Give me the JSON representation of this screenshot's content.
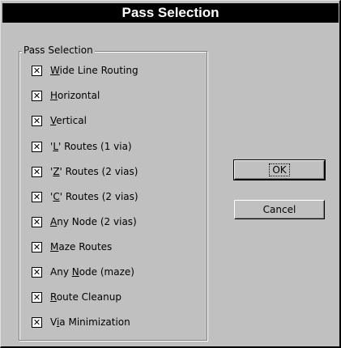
{
  "window": {
    "title": "Pass Selection"
  },
  "group": {
    "label": "Pass Selection"
  },
  "passes": [
    {
      "pre": "",
      "u": "W",
      "post": "ide Line Routing",
      "checked": true
    },
    {
      "pre": "",
      "u": "H",
      "post": "orizontal",
      "checked": true
    },
    {
      "pre": "",
      "u": "V",
      "post": "ertical",
      "checked": true
    },
    {
      "pre": "'",
      "u": "L",
      "post": "' Routes (1 via)",
      "checked": true
    },
    {
      "pre": "'",
      "u": "Z",
      "post": "' Routes (2 vias)",
      "checked": true
    },
    {
      "pre": "'",
      "u": "C",
      "post": "' Routes (2 vias)",
      "checked": true
    },
    {
      "pre": "",
      "u": "A",
      "post": "ny Node (2 vias)",
      "checked": true
    },
    {
      "pre": "",
      "u": "M",
      "post": "aze Routes",
      "checked": true
    },
    {
      "pre": "Any ",
      "u": "N",
      "post": "ode (maze)",
      "checked": true
    },
    {
      "pre": "",
      "u": "R",
      "post": "oute Cleanup",
      "checked": true
    },
    {
      "pre": "V",
      "u": "i",
      "post": "a Minimization",
      "checked": true
    }
  ],
  "buttons": {
    "ok": {
      "label": "OK"
    },
    "cancel": {
      "label": "Cancel"
    }
  }
}
